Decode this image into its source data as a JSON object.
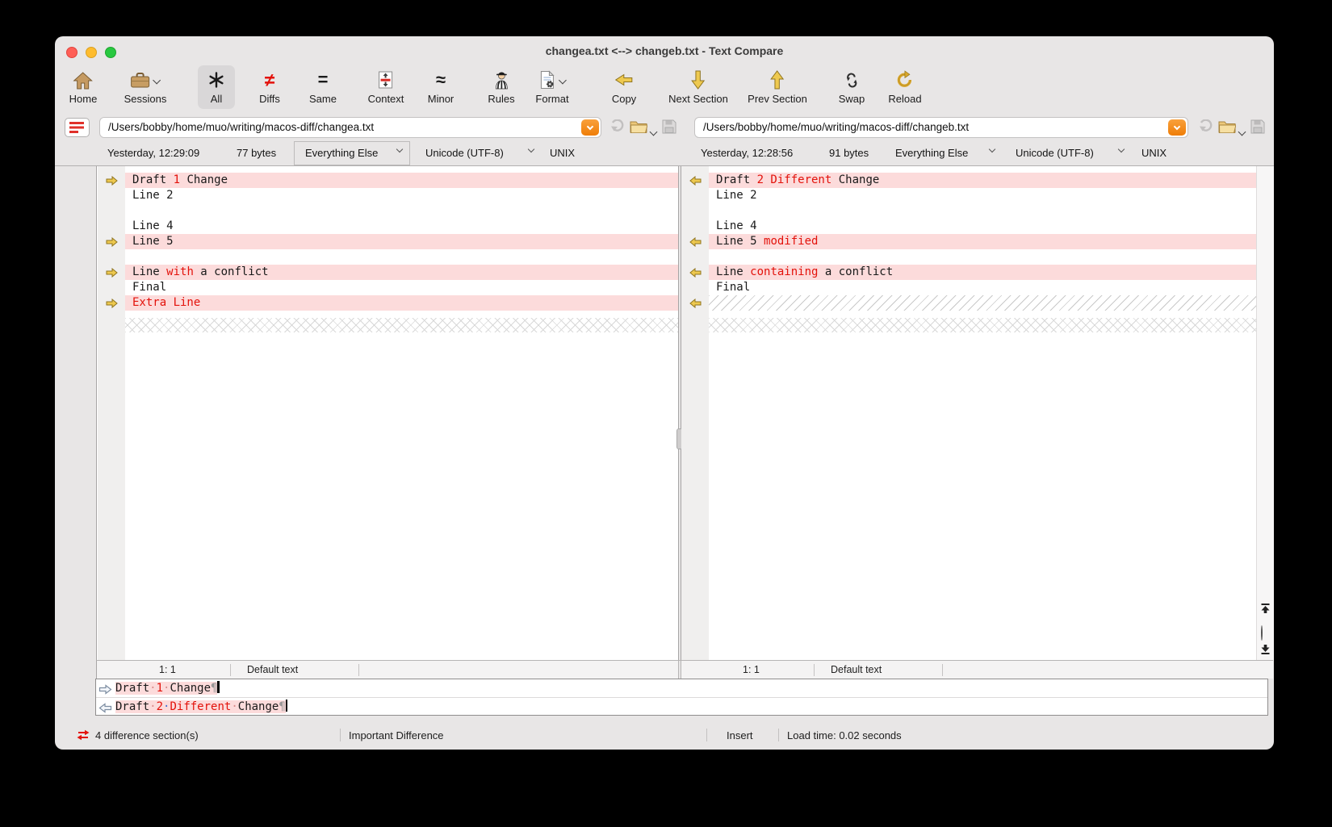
{
  "window": {
    "title": "changea.txt <--> changeb.txt - Text Compare"
  },
  "toolbar": {
    "items": [
      {
        "id": "home",
        "label": "Home"
      },
      {
        "id": "sessions",
        "label": "Sessions",
        "chevron": true
      },
      {
        "id": "all",
        "label": "All",
        "selected": true
      },
      {
        "id": "diffs",
        "label": "Diffs"
      },
      {
        "id": "same",
        "label": "Same"
      },
      {
        "id": "context",
        "label": "Context"
      },
      {
        "id": "minor",
        "label": "Minor"
      },
      {
        "id": "rules",
        "label": "Rules"
      },
      {
        "id": "format",
        "label": "Format",
        "chevron": true
      },
      {
        "id": "copy",
        "label": "Copy"
      },
      {
        "id": "next-section",
        "label": "Next Section"
      },
      {
        "id": "prev-section",
        "label": "Prev Section"
      },
      {
        "id": "swap",
        "label": "Swap"
      },
      {
        "id": "reload",
        "label": "Reload"
      }
    ]
  },
  "left_pane": {
    "path": "/Users/bobby/home/muo/writing/macos-diff/changea.txt",
    "modified": "Yesterday, 12:29:09",
    "size": "77 bytes",
    "filter": "Everything Else",
    "encoding": "Unicode (UTF-8)",
    "line_endings": "UNIX",
    "cursor_position": "1: 1",
    "syntax": "Default text",
    "lines": [
      {
        "hl": true,
        "arrow": true,
        "parts": [
          {
            "t": "Draft ",
            "c": "k"
          },
          {
            "t": "1",
            "c": "r"
          },
          {
            "t": " Change",
            "c": "k"
          }
        ]
      },
      {
        "parts": [
          {
            "t": "Line 2",
            "c": "k"
          }
        ]
      },
      {
        "parts": []
      },
      {
        "parts": [
          {
            "t": "Line 4",
            "c": "k"
          }
        ]
      },
      {
        "hl": true,
        "arrow": true,
        "parts": [
          {
            "t": "Line 5",
            "c": "k"
          }
        ]
      },
      {
        "parts": []
      },
      {
        "hl": true,
        "arrow": true,
        "parts": [
          {
            "t": "Line ",
            "c": "k"
          },
          {
            "t": "with",
            "c": "r"
          },
          {
            "t": " a conflict",
            "c": "k"
          }
        ]
      },
      {
        "parts": [
          {
            "t": "Final",
            "c": "k"
          }
        ]
      },
      {
        "hl": true,
        "arrow": true,
        "parts": [
          {
            "t": "Extra Line",
            "c": "r"
          }
        ]
      }
    ]
  },
  "right_pane": {
    "path": "/Users/bobby/home/muo/writing/macos-diff/changeb.txt",
    "modified": "Yesterday, 12:28:56",
    "size": "91 bytes",
    "filter": "Everything Else",
    "encoding": "Unicode (UTF-8)",
    "line_endings": "UNIX",
    "cursor_position": "1: 1",
    "syntax": "Default text",
    "lines": [
      {
        "hl": true,
        "arrow": true,
        "parts": [
          {
            "t": "Draft ",
            "c": "k"
          },
          {
            "t": "2 Different",
            "c": "r"
          },
          {
            "t": " Change",
            "c": "k"
          }
        ]
      },
      {
        "parts": [
          {
            "t": "Line 2",
            "c": "k"
          }
        ]
      },
      {
        "parts": []
      },
      {
        "parts": [
          {
            "t": "Line 4",
            "c": "k"
          }
        ]
      },
      {
        "hl": true,
        "arrow": true,
        "parts": [
          {
            "t": "Line 5 ",
            "c": "k"
          },
          {
            "t": "modified",
            "c": "r"
          }
        ]
      },
      {
        "parts": []
      },
      {
        "hl": true,
        "arrow": true,
        "parts": [
          {
            "t": "Line ",
            "c": "k"
          },
          {
            "t": "containing",
            "c": "r"
          },
          {
            "t": " a conflict",
            "c": "k"
          }
        ]
      },
      {
        "parts": [
          {
            "t": "Final",
            "c": "k"
          }
        ]
      },
      {
        "missing": true,
        "arrow": true,
        "parts": []
      }
    ]
  },
  "detail": {
    "rows": [
      {
        "direction": "right",
        "parts": [
          {
            "t": "Draft",
            "c": "k"
          },
          {
            "t": "·",
            "c": "d"
          },
          {
            "t": "1",
            "c": "r"
          },
          {
            "t": "·",
            "c": "d"
          },
          {
            "t": "Change",
            "c": "k"
          },
          {
            "t": "¶",
            "c": "p"
          }
        ]
      },
      {
        "direction": "left",
        "parts": [
          {
            "t": "Draft",
            "c": "k"
          },
          {
            "t": "·",
            "c": "d"
          },
          {
            "t": "2",
            "c": "r"
          },
          {
            "t": "·",
            "c": "b"
          },
          {
            "t": "Different",
            "c": "r"
          },
          {
            "t": "·",
            "c": "d"
          },
          {
            "t": "Change",
            "c": "k"
          },
          {
            "t": "¶",
            "c": "p"
          }
        ]
      }
    ]
  },
  "status_bar": {
    "sections": "4 difference section(s)",
    "importance": "Important Difference",
    "mode": "Insert",
    "load_time": "Load time: 0.02 seconds"
  },
  "colors": {
    "accent_orange": "#f6830f",
    "diff_row_bg": "#fcdbdb",
    "diff_text_red": "#e3120b",
    "section_arrow_gold": "#eec94f",
    "traffic_red": "#ff5f57",
    "traffic_yellow": "#febc2e",
    "traffic_green": "#28c840"
  }
}
